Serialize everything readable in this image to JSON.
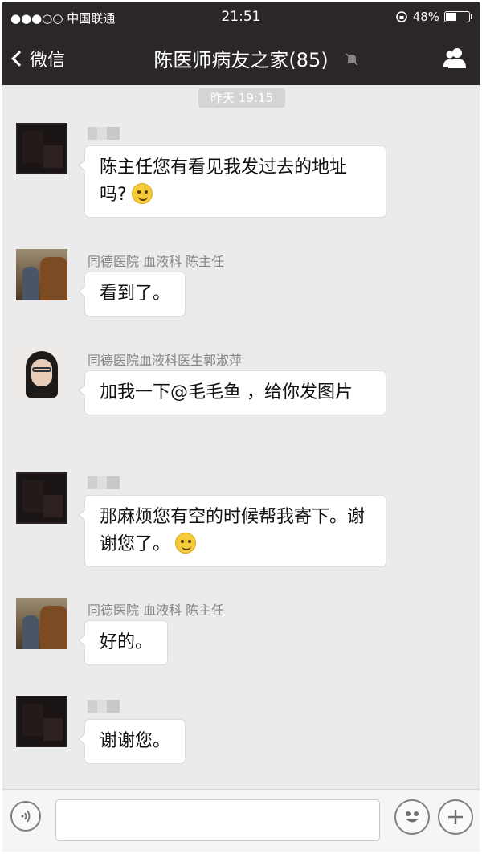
{
  "status_bar": {
    "carrier": "●●●○○ 中国联通",
    "time": "21:51",
    "battery": "48%",
    "battery_level": 0.48
  },
  "nav": {
    "back_label": "微信",
    "title": "陈医师病友之家(85)"
  },
  "chat": {
    "timestamp": "昨天 19:15",
    "messages": [
      {
        "sender": "",
        "text": "陈主任您有看见我发过去的地址吗?"
      },
      {
        "sender": "同德医院 血液科 陈主任",
        "text": "看到了。"
      },
      {
        "sender": "同德医院血液科医生郭淑萍",
        "text": "加我一下@毛毛鱼 ，给你发图片"
      },
      {
        "sender": "",
        "text": "那麻烦您有空的时候帮我寄下。谢谢您了。"
      },
      {
        "sender": "同德医院 血液科 陈主任",
        "text": "好的。"
      },
      {
        "sender": "",
        "text": "谢谢您。"
      }
    ]
  },
  "input_bar": {
    "placeholder": ""
  }
}
